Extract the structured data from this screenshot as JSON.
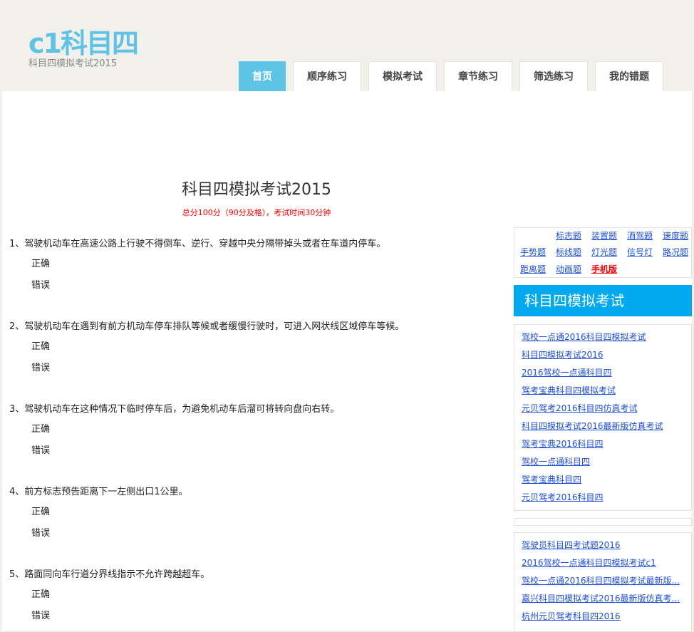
{
  "header": {
    "logo": "c1科目四",
    "subtitle": "科目四模拟考试2015"
  },
  "nav": [
    "首页",
    "顺序练习",
    "模拟考试",
    "章节练习",
    "筛选练习",
    "我的错题"
  ],
  "exam": {
    "title": "科目四模拟考试2015",
    "note": "总分100分（90分及格），考试时间30分钟"
  },
  "questions": [
    {
      "text": "1、驾驶机动车在高速公路上行驶不得倒车、逆行、穿越中央分隔带掉头或者在车道内停车。",
      "options": [
        "正确",
        "错误"
      ]
    },
    {
      "text": "2、驾驶机动车在遇到有前方机动车停车排队等候或者缓慢行驶时，可进入网状线区域停车等候。",
      "options": [
        "正确",
        "错误"
      ]
    },
    {
      "text": "3、驾驶机动车在这种情况下临时停车后，为避免机动车后溜可将转向盘向右转。",
      "options": [
        "正确",
        "错误"
      ]
    },
    {
      "text": "4、前方标志预告距离下一左侧出口1公里。",
      "options": [
        "正确",
        "错误"
      ]
    },
    {
      "text": "5、路面同向车行道分界线指示不允许跨越超车。",
      "options": [
        "正确",
        "错误"
      ]
    }
  ],
  "sidebar": {
    "tags": [
      "",
      "标志题",
      "装置题",
      "酒驾题",
      "速度题",
      "手势题",
      "标线题",
      "灯光题",
      "信号灯",
      "路况题",
      "距离题",
      "动画题",
      "手机版"
    ],
    "highlight_color": "#ff0000",
    "header": "科目四模拟考试",
    "links1": [
      "驾校一点通2016科目四模拟考试",
      "科目四模拟考试2016",
      "2016驾校一点通科目四",
      "驾考宝典科目四模拟考试",
      "元贝驾考2016科目四仿真考试",
      "科目四模拟考试2016最新版仿真考试",
      "驾考宝典2016科目四",
      "驾校一点通科目四",
      "驾考宝典科目四",
      "元贝驾考2016科目四"
    ],
    "links2": [
      "驾驶员科目四考试题2016",
      "2016驾校一点通科目四模拟考试c1",
      "驾校一点通2016科目四模拟考试最新版...",
      "嘉兴科目四模拟考试2016最新版仿真考...",
      "杭州元贝驾考科目四2016"
    ]
  },
  "colors": {
    "accent": "#5fc3e6",
    "sidebar_header": "#00a9f0",
    "link": "#1d4fd8"
  }
}
